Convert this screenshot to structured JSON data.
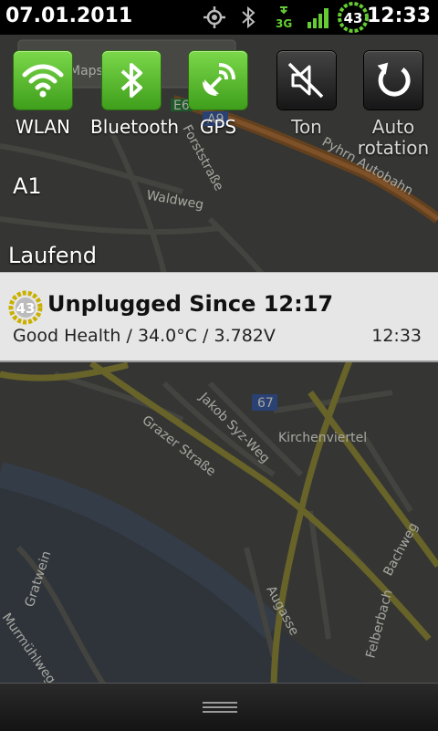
{
  "status_bar": {
    "date": "07.01.2011",
    "time": "12:33",
    "battery_level": "43",
    "network": "3G"
  },
  "quick_settings": [
    {
      "label": "WLAN",
      "state": "on",
      "icon": "wifi-icon"
    },
    {
      "label": "Bluetooth",
      "state": "on",
      "icon": "bluetooth-icon"
    },
    {
      "label": "GPS",
      "state": "on",
      "icon": "gps-icon"
    },
    {
      "label": "Ton",
      "state": "off",
      "icon": "sound-muted-icon"
    },
    {
      "label": "Auto rotation",
      "label_line1": "Auto",
      "label_line2": "rotation",
      "state": "off",
      "icon": "rotate-icon"
    }
  ],
  "carrier": "A1",
  "ongoing_header": "Laufend",
  "notification": {
    "title": "Unplugged Since 12:17",
    "text": "Good Health / 34.0°C / 3.782V",
    "time": "12:33",
    "icon_value": "43"
  },
  "map_labels": {
    "search_hint": "Maps suchen",
    "forststrasse": "Forststraße",
    "waldweg": "Waldweg",
    "autobahn": "Pyhrn Autobahn",
    "a9": "A9",
    "e": "E6",
    "jakob": "Jakob Syz-Weg",
    "kirchenviertel": "Kirchenviertel",
    "grazer": "Grazer Straße",
    "route67": "67",
    "gratwein": "Gratwein",
    "murmuehlweg": "Murmühlweg",
    "augasse": "Augasse",
    "bachweg": "Bachweg",
    "felberbach": "Felberbach"
  },
  "colors": {
    "toggle_on": "#5cbf2a",
    "toggle_off": "#262626",
    "status_bar_bg": "#000000",
    "notification_bg": "#e6e6e6"
  }
}
